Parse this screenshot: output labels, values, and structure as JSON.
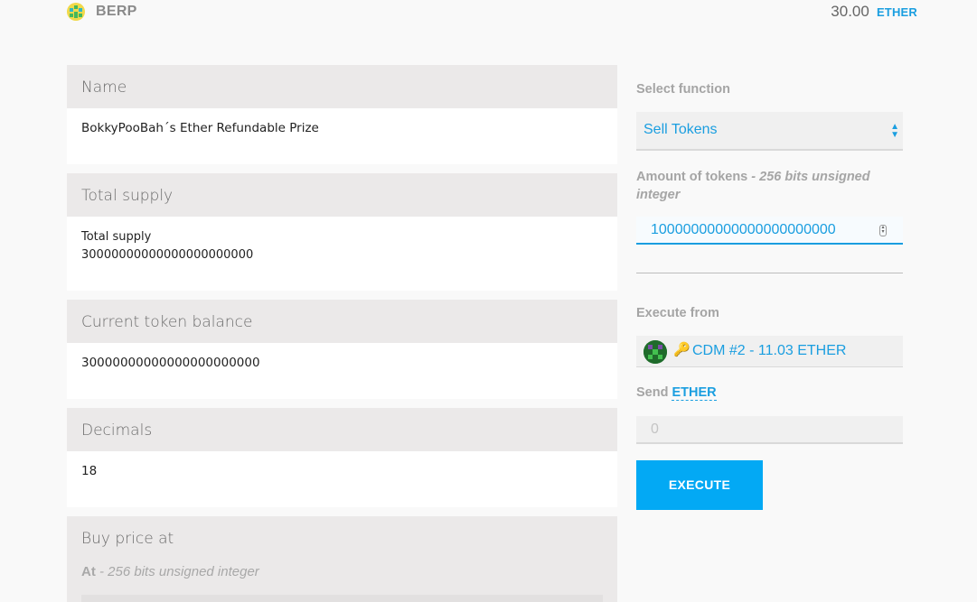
{
  "app": {
    "title": "BERP",
    "balance_amount": "30.00",
    "balance_unit": "ETHER"
  },
  "fields": {
    "name": {
      "label": "Name",
      "value": "BokkyPooBah´s Ether Refundable Prize"
    },
    "total_supply": {
      "label": "Total supply",
      "sublabel": "Total supply",
      "value": "30000000000000000000000"
    },
    "token_balance": {
      "label": "Current token balance",
      "value": "30000000000000000000000"
    },
    "decimals": {
      "label": "Decimals",
      "value": "18"
    },
    "buy_price": {
      "label": "Buy price at",
      "hint_name": "At",
      "hint_type": " - 256 bits unsigned integer"
    }
  },
  "execute_panel": {
    "select_function_label": "Select function",
    "selected_function": "Sell Tokens",
    "amount_label": "Amount of tokens",
    "amount_type": " - 256 bits unsigned integer",
    "amount_value": "10000000000000000000000",
    "execute_from_label": "Execute from",
    "account": "CDM #2 - 11.03 ETHER",
    "send_label": "Send",
    "send_unit": "ETHER",
    "send_value": "0",
    "execute_button": "EXECUTE"
  }
}
